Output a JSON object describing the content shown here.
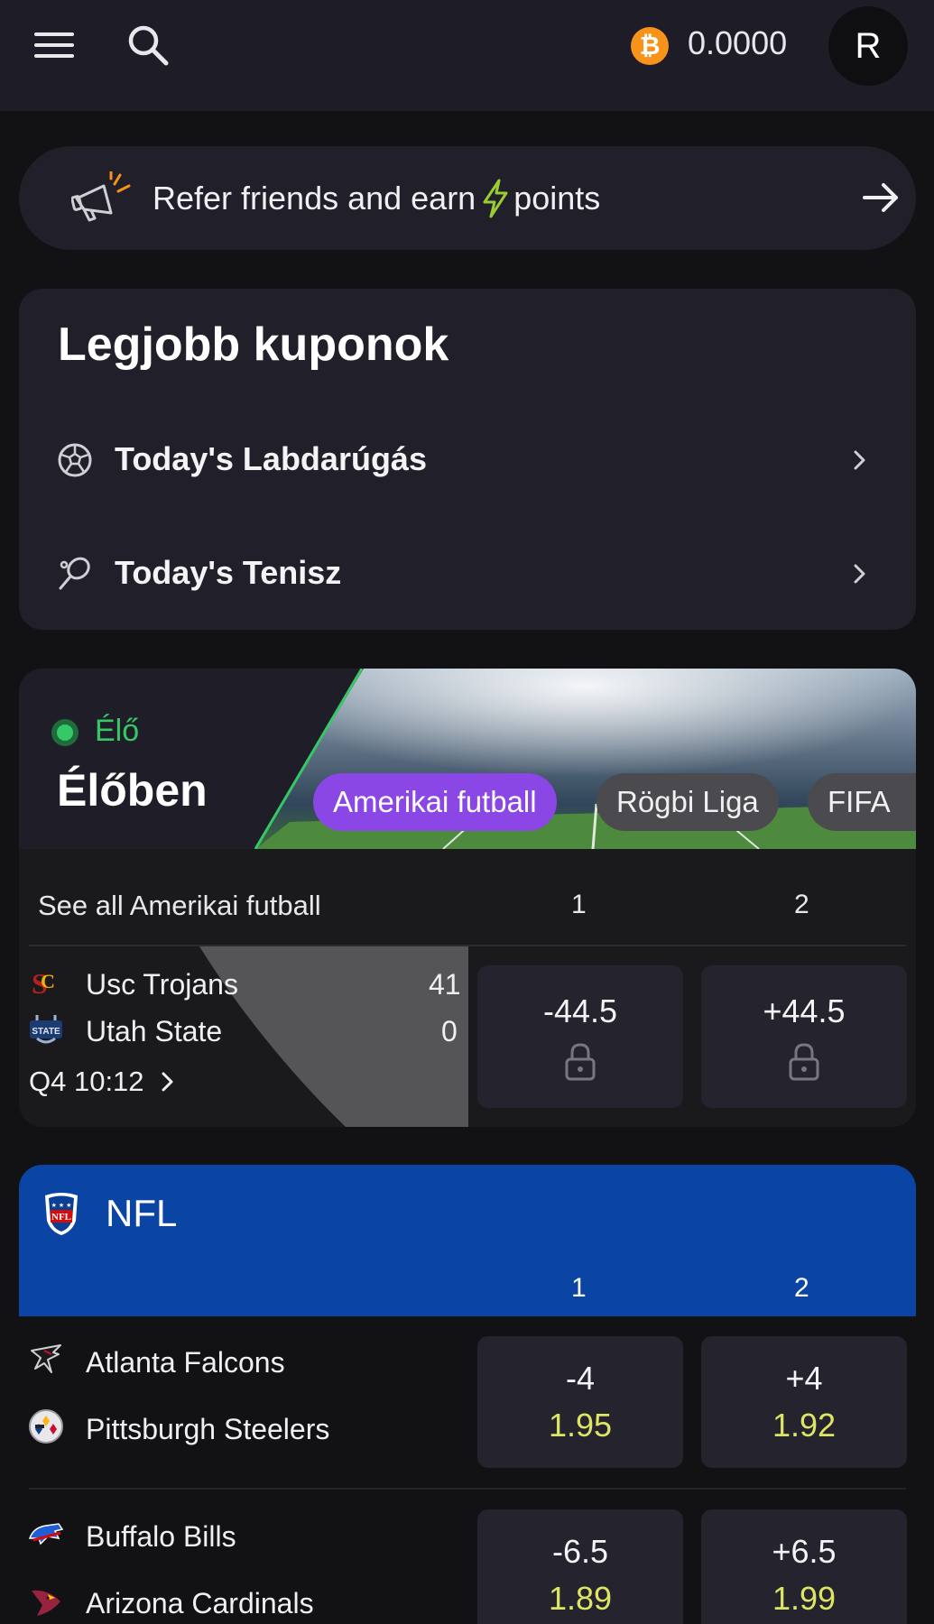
{
  "header": {
    "balance": "0.0000",
    "avatar_initial": "R",
    "currency_icon": "bitcoin-icon"
  },
  "referral": {
    "text_before": "Refer friends and earn",
    "text_after": "points"
  },
  "coupons": {
    "title": "Legjobb kuponok",
    "items": [
      {
        "label": "Today's Labdarúgás",
        "icon": "soccer-ball-icon"
      },
      {
        "label": "Today's Tenisz",
        "icon": "tennis-racket-icon"
      }
    ]
  },
  "live": {
    "status": "Élő",
    "title": "Élőben",
    "chips": [
      "Amerikai futball",
      "Rögbi Liga",
      "FIFA"
    ],
    "see_all": "See all Amerikai futball",
    "col1": "1",
    "col2": "2",
    "match": {
      "team1": "Usc Trojans",
      "team2": "Utah State",
      "score1": "41",
      "score2": "0",
      "clock": "Q4 10:12",
      "odd1": "-44.5",
      "odd2": "+44.5"
    }
  },
  "nfl": {
    "title": "NFL",
    "col1": "1",
    "col2": "2",
    "matches": [
      {
        "team1": "Atlanta Falcons",
        "team2": "Pittsburgh Steelers",
        "line1": "-4",
        "price1": "1.95",
        "line2": "+4",
        "price2": "1.92"
      },
      {
        "team1": "Buffalo Bills",
        "team2": "Arizona Cardinals",
        "line1": "-6.5",
        "price1": "1.89",
        "line2": "+6.5",
        "price2": "1.99"
      }
    ]
  },
  "colors": {
    "accent_purple": "#8b46e6",
    "live_green": "#35c867",
    "odds_yellow": "#dde563",
    "nfl_blue": "#0b45a4"
  }
}
